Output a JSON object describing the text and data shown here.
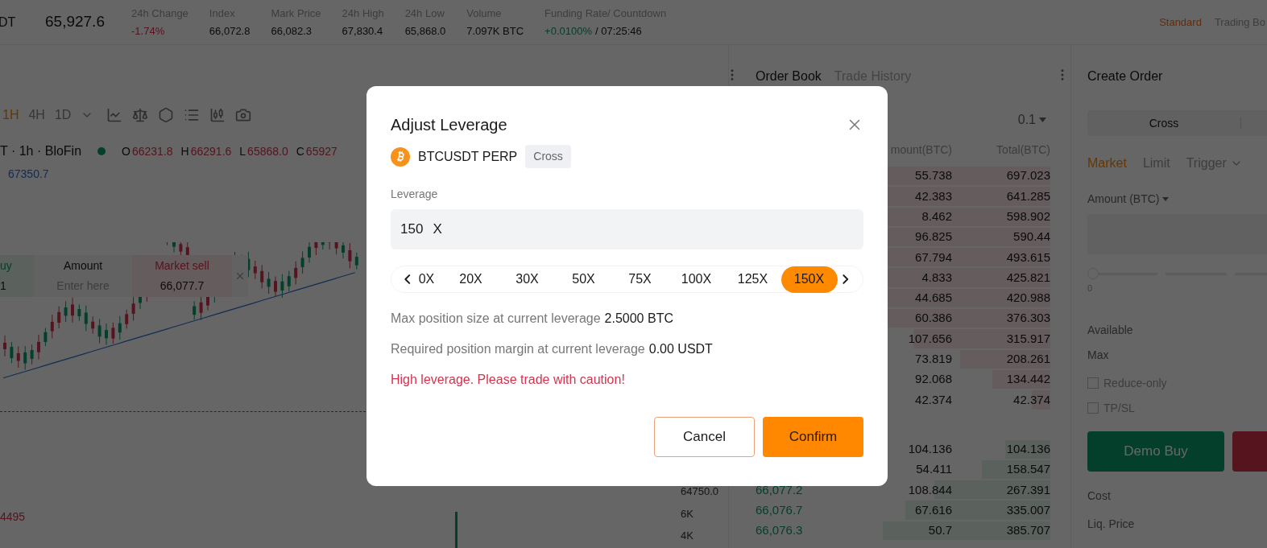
{
  "ticker": {
    "symbol": "DT",
    "price": "65,927.6",
    "stats": [
      {
        "label": "24h Change",
        "values": [
          {
            "text": "-1.74%",
            "kind": "loss"
          }
        ]
      },
      {
        "label": "Index",
        "values": [
          {
            "text": "66,072.8"
          }
        ]
      },
      {
        "label": "Mark Price",
        "values": [
          {
            "text": "66,082.3"
          }
        ]
      },
      {
        "label": "24h High",
        "values": [
          {
            "text": "67,830.4"
          }
        ]
      },
      {
        "label": "24h Low",
        "values": [
          {
            "text": "65,868.0"
          }
        ]
      },
      {
        "label": "Volume",
        "values": [
          {
            "text": "7.097K BTC"
          }
        ]
      },
      {
        "label": "Funding Rate/ Countdown",
        "values": [
          {
            "text": "+0.0100%",
            "kind": "gain"
          },
          {
            "text": "/ 07:25:46"
          }
        ]
      }
    ],
    "view_modes": [
      {
        "label": "Standard",
        "selected": true
      },
      {
        "label": "Trading Bo",
        "selected": false
      }
    ]
  },
  "chart": {
    "intervals": [
      {
        "label": "1H",
        "selected": true
      },
      {
        "label": "4H",
        "selected": false
      },
      {
        "label": "1D",
        "selected": false
      }
    ],
    "legend": {
      "title": "T · 1h · BloFin",
      "ohlc": [
        {
          "key": "O",
          "value": "66231.8"
        },
        {
          "key": "H",
          "value": "66291.6"
        },
        {
          "key": "L",
          "value": "65868.0"
        },
        {
          "key": "C",
          "value": "65927"
        }
      ]
    },
    "ma_label": "67350.7",
    "low_label": "4495",
    "axis_labels": [
      "64750.0",
      "6K",
      "4K"
    ],
    "quick_order": {
      "buy_label": "uy",
      "buy_value": "1",
      "amount_label": "Amount",
      "amount_placeholder": "Enter here",
      "sell_label": "Market sell",
      "sell_value": "66,077.7"
    }
  },
  "order_book": {
    "tabs": [
      {
        "label": "Order Book",
        "selected": true
      },
      {
        "label": "Trade History",
        "selected": false
      }
    ],
    "precision": "0.1",
    "columns": [
      "mount(BTC)",
      "Total(BTC)"
    ],
    "asks": [
      {
        "amount": "55.738",
        "total": "697.023"
      },
      {
        "amount": "42.383",
        "total": "641.285"
      },
      {
        "amount": "8.462",
        "total": "598.902"
      },
      {
        "amount": "96.825",
        "total": "590.44"
      },
      {
        "amount": "67.794",
        "total": "493.615"
      },
      {
        "amount": "4.833",
        "total": "425.821"
      },
      {
        "amount": "44.685",
        "total": "420.988"
      },
      {
        "amount": "60.386",
        "total": "376.303"
      },
      {
        "amount": "107.656",
        "total": "315.917"
      },
      {
        "amount": "73.819",
        "total": "208.261"
      },
      {
        "amount": "92.068",
        "total": "134.442"
      },
      {
        "amount": "42.374",
        "total": "42.374"
      }
    ],
    "bids": [
      {
        "amount": "104.136",
        "total": "104.136"
      },
      {
        "amount": "54.411",
        "total": "158.547"
      },
      {
        "price": "66,077.2",
        "amount": "108.844",
        "total": "267.391"
      },
      {
        "price": "66,076.7",
        "amount": "67.616",
        "total": "335.007"
      },
      {
        "price": "66,076.3",
        "amount": "50.7",
        "total": "385.707"
      }
    ]
  },
  "create_order": {
    "title": "Create Order",
    "margin_mode": "Cross",
    "order_types": [
      {
        "label": "Market",
        "selected": true
      },
      {
        "label": "Limit",
        "selected": false
      },
      {
        "label": "Trigger",
        "selected": false
      }
    ],
    "amount_label": "Amount (BTC)",
    "slider": {
      "level": 0,
      "label": "0"
    },
    "available_label": "Available",
    "max_label": "Max",
    "options": [
      {
        "label": "Reduce-only",
        "checked": false
      },
      {
        "label": "TP/SL",
        "checked": false
      }
    ],
    "buy_button": "Demo Buy",
    "cost_label": "Cost",
    "liq_label": "Liq. Price"
  },
  "dialog": {
    "title": "Adjust Leverage",
    "symbol": "BTCUSDT PERP",
    "mode": "Cross",
    "field_label": "Leverage",
    "value": "150",
    "unit": "X",
    "presets": [
      {
        "label": "0X",
        "selected": false
      },
      {
        "label": "20X",
        "selected": false
      },
      {
        "label": "30X",
        "selected": false
      },
      {
        "label": "50X",
        "selected": false
      },
      {
        "label": "75X",
        "selected": false
      },
      {
        "label": "100X",
        "selected": false
      },
      {
        "label": "125X",
        "selected": false
      },
      {
        "label": "150X",
        "selected": true
      }
    ],
    "lines": [
      {
        "label": "Max position size at current leverage",
        "value": "2.5000 BTC"
      },
      {
        "label": "Required position margin at current leverage",
        "value": "0.00 USDT"
      }
    ],
    "warning": "High leverage. Please trade with caution!",
    "buttons": [
      {
        "label": "Cancel",
        "kind": "secondary"
      },
      {
        "label": "Confirm",
        "kind": "primary"
      }
    ]
  }
}
